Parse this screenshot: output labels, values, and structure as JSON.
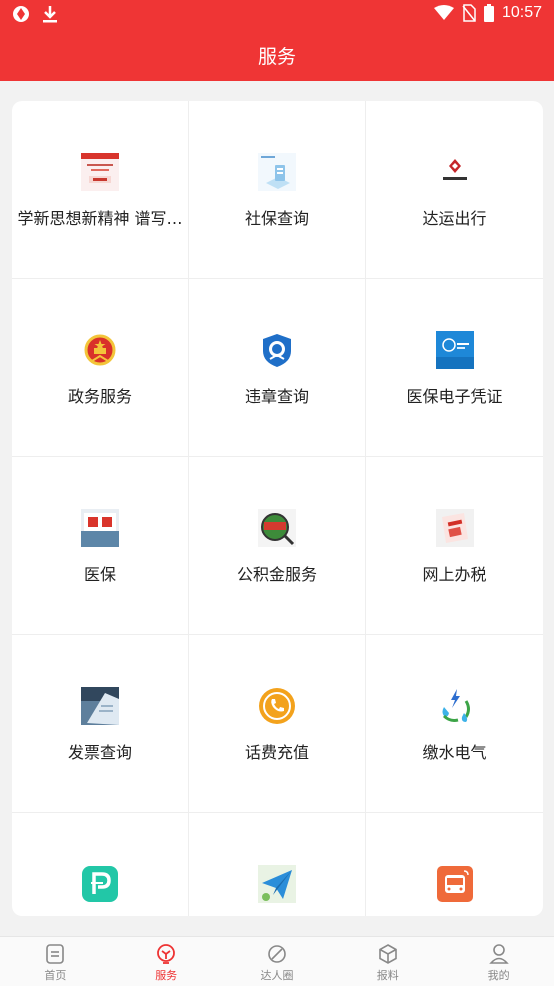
{
  "status_bar": {
    "time": "10:57"
  },
  "header": {
    "title": "服务"
  },
  "services": [
    {
      "label": "学新思想新精神 谱写…",
      "icon": "document-thumbnail-icon"
    },
    {
      "label": "社保查询",
      "icon": "social-security-icon"
    },
    {
      "label": "达运出行",
      "icon": "dayun-logo-icon"
    },
    {
      "label": "政务服务",
      "icon": "national-emblem-icon"
    },
    {
      "label": "违章查询",
      "icon": "traffic-police-icon"
    },
    {
      "label": "医保电子凭证",
      "icon": "medical-voucher-icon"
    },
    {
      "label": "医保",
      "icon": "medical-insurance-icon"
    },
    {
      "label": "公积金服务",
      "icon": "housing-fund-icon"
    },
    {
      "label": "网上办税",
      "icon": "tax-icon"
    },
    {
      "label": "发票查询",
      "icon": "invoice-icon"
    },
    {
      "label": "话费充值",
      "icon": "phone-recharge-icon"
    },
    {
      "label": "缴水电气",
      "icon": "utilities-icon"
    },
    {
      "label": "",
      "icon": "parking-icon"
    },
    {
      "label": "",
      "icon": "paper-plane-icon"
    },
    {
      "label": "",
      "icon": "bus-icon"
    }
  ],
  "tabs": [
    {
      "label": "首页",
      "icon": "home-icon"
    },
    {
      "label": "服务",
      "icon": "service-icon",
      "active": true
    },
    {
      "label": "达人圈",
      "icon": "circle-icon"
    },
    {
      "label": "报料",
      "icon": "box-icon"
    },
    {
      "label": "我的",
      "icon": "profile-icon"
    }
  ],
  "colors": {
    "brand": "#ef3535",
    "active_tab": "#e33333",
    "tab_inactive": "#888888"
  }
}
